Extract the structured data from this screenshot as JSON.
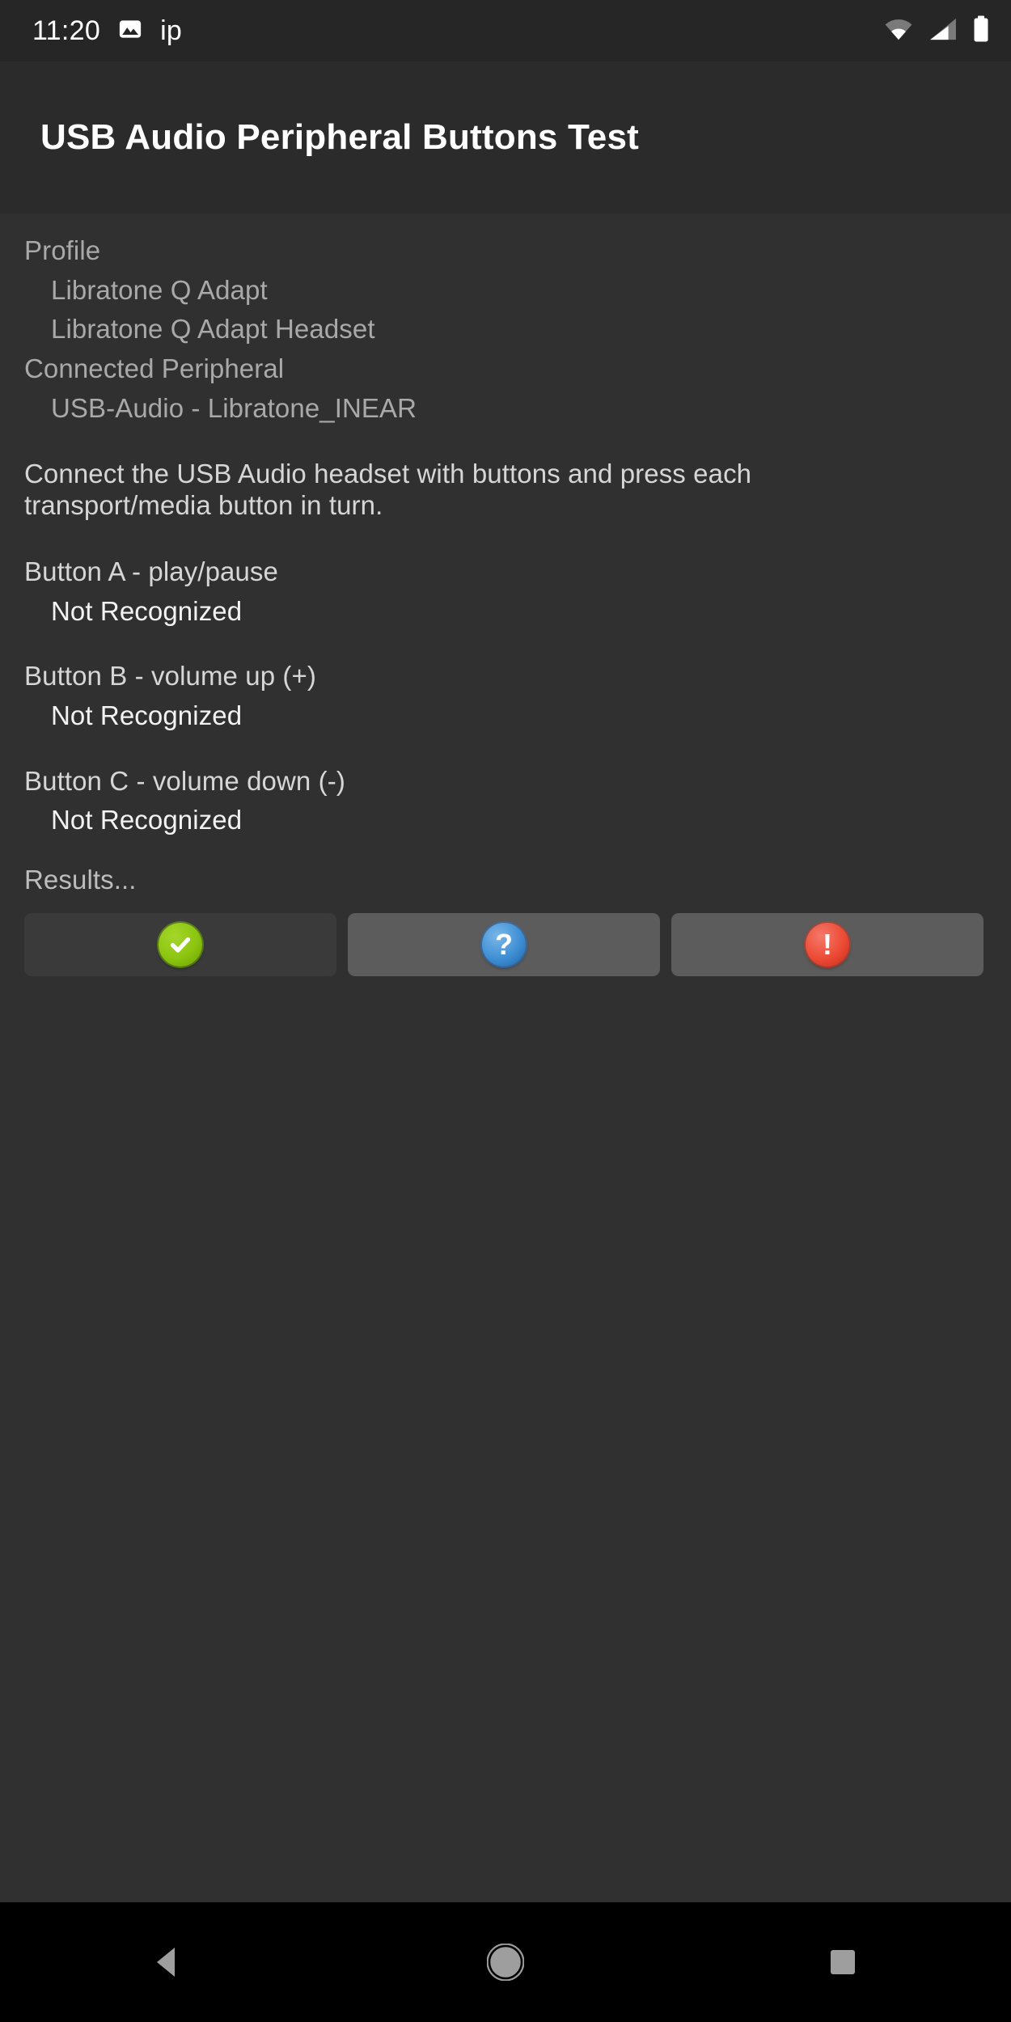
{
  "status_bar": {
    "clock": "11:20",
    "notification_icon": "image-icon",
    "notification_text": "ip",
    "wifi_icon": "wifi-icon",
    "signal_icon": "cell-signal-icon",
    "battery_icon": "battery-full-icon"
  },
  "action_bar": {
    "title": "USB Audio Peripheral Buttons Test"
  },
  "content": {
    "profile_label": "Profile",
    "profile_values": [
      "Libratone Q Adapt",
      "Libratone Q Adapt Headset"
    ],
    "connected_label": "Connected Peripheral",
    "connected_values": [
      "USB-Audio - Libratone_INEAR"
    ],
    "instructions": "Connect the USB Audio headset with buttons and press each transport/media button in turn.",
    "buttons": [
      {
        "label": "Button A - play/pause",
        "status": "Not Recognized"
      },
      {
        "label": "Button B - volume up (+)",
        "status": "Not Recognized"
      },
      {
        "label": "Button C - volume down (-)",
        "status": "Not Recognized"
      }
    ],
    "results_label": "Results...",
    "result_buttons": [
      {
        "name": "pass-button",
        "icon": "check-circle-icon",
        "glyph": "✔",
        "state": "disabled",
        "color": "#8cc510"
      },
      {
        "name": "info-button",
        "icon": "question-circle-icon",
        "glyph": "?",
        "state": "enabled",
        "color": "#3f8fd4"
      },
      {
        "name": "fail-button",
        "icon": "exclamation-circle-icon",
        "glyph": "!",
        "state": "enabled",
        "color": "#ed4b35"
      }
    ]
  },
  "nav_bar": {
    "back": "back-icon",
    "home": "home-icon",
    "recents": "recents-icon"
  },
  "colors": {
    "window_bg": "#303030",
    "action_bar_bg": "#2b2b2b",
    "status_bar_bg": "#262626",
    "nav_bar_bg": "#000000",
    "button_disabled_bg": "#3a3a3a",
    "button_enabled_bg": "#5c5c5c"
  }
}
